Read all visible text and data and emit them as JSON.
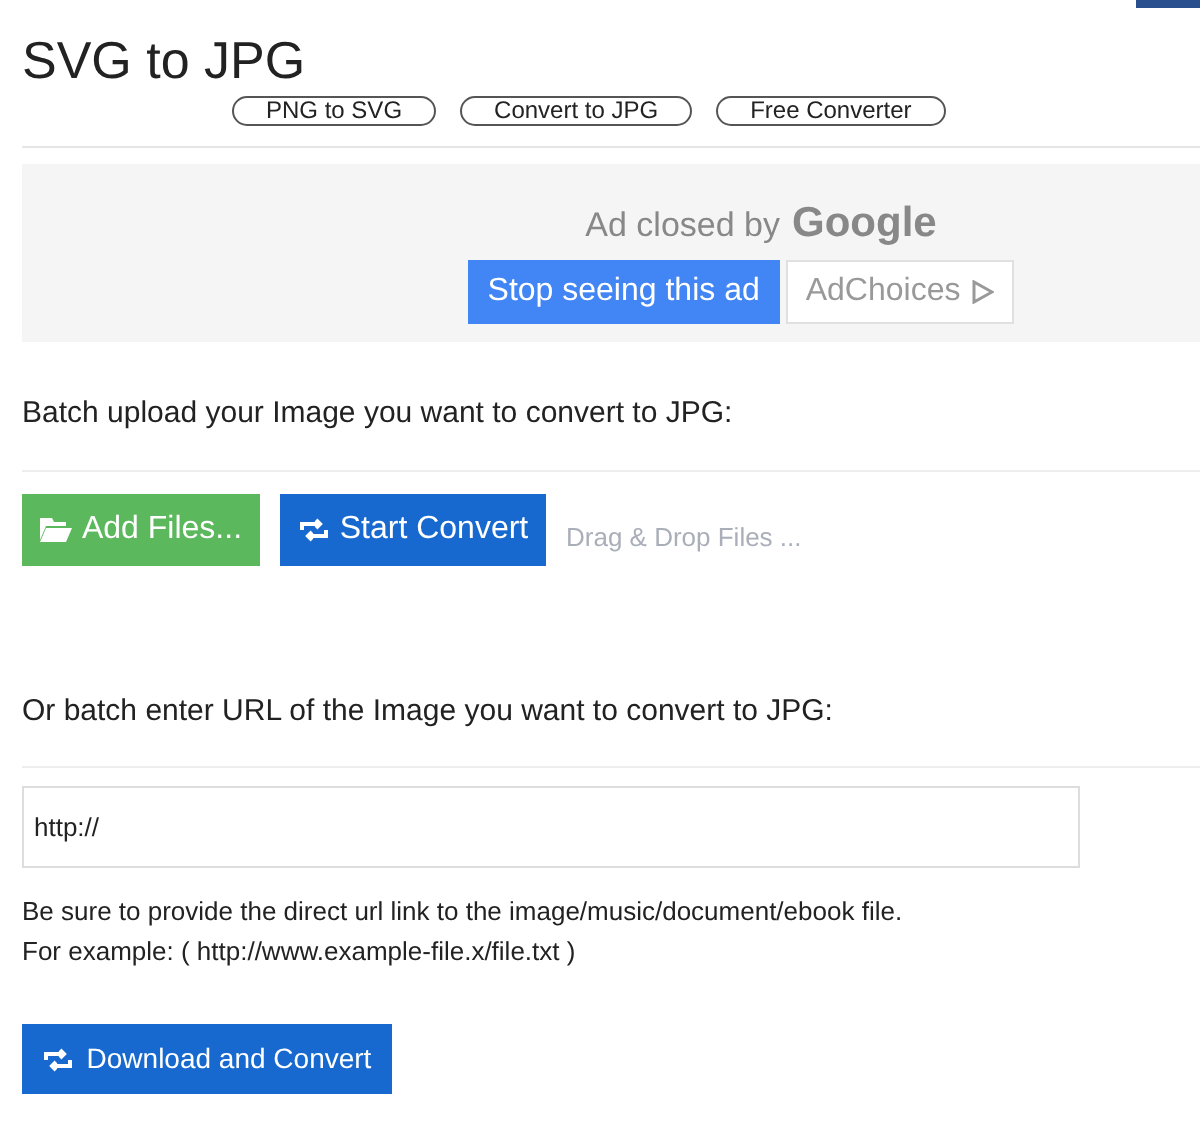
{
  "title": "SVG to JPG",
  "links": [
    "PNG to SVG",
    "Convert to JPG",
    "Free Converter"
  ],
  "ad": {
    "text": "Ad closed by",
    "logo": "Google",
    "stop_button": "Stop seeing this ad",
    "choices_button": "AdChoices"
  },
  "upload": {
    "label": "Batch upload your Image you want to convert to JPG:",
    "add_button": "Add Files...",
    "start_button": "Start Convert",
    "drop_hint": "Drag & Drop Files ..."
  },
  "url": {
    "label": "Or batch enter URL of the Image you want to convert to JPG:",
    "value": "http://",
    "notes": [
      "Be sure to provide the direct url link to the image/music/document/ebook file.",
      "For example: ( http://www.example-file.x/file.txt )"
    ],
    "button": "Download and Convert"
  }
}
